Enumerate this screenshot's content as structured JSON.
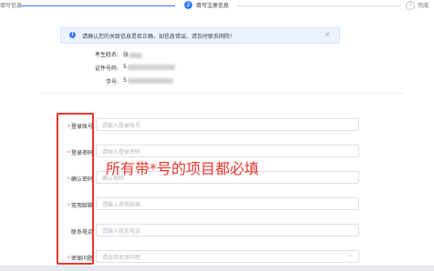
{
  "stepper": {
    "step1_label": "填写信息",
    "step2_number": "2",
    "step2_label": "填写注册信息",
    "step3_number": "3",
    "step3_label": "完成"
  },
  "alert": {
    "text": "请确认您的关联信息是否正确，如信息错误，请及时联系网院!",
    "close": "×"
  },
  "info": {
    "name_label": "考生姓名:",
    "name_value": "张",
    "id_label": "证件号码:",
    "id_value": "5",
    "sno_label": "学号:",
    "sno_value": "5"
  },
  "form": {
    "fields": [
      {
        "label": "登录账号",
        "required": "*",
        "placeholder": "请输入登录账号"
      },
      {
        "label": "登录密码",
        "required": "*",
        "placeholder": "请输入登录密码"
      },
      {
        "label": "确认密码",
        "required": "*",
        "placeholder": "确认密码"
      },
      {
        "label": "常用邮箱",
        "required": "*",
        "placeholder": "请输入常用邮箱"
      },
      {
        "label": "联系电话",
        "required": "",
        "placeholder": "请输入联系电话"
      },
      {
        "label": "密保问题",
        "required": "*",
        "placeholder": "请选择密保问题"
      }
    ],
    "select_arrow": "⌄"
  },
  "annotation": {
    "text": "所有带*号的项目都必填"
  },
  "colors": {
    "accent": "#3a7bff",
    "annotation": "#e8362b",
    "required": "#f56c6c"
  }
}
